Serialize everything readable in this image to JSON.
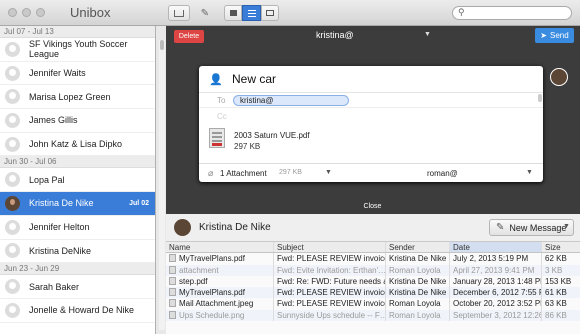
{
  "app": {
    "title": "Unibox"
  },
  "sidebar": {
    "groups": [
      {
        "date": "Jul 07 - Jul 13",
        "items": [
          {
            "name": "SF Vikings Youth Soccer League",
            "date": ""
          },
          {
            "name": "Jennifer Waits",
            "date": ""
          },
          {
            "name": "Marisa Lopez Green",
            "date": ""
          },
          {
            "name": "James Gillis",
            "date": ""
          },
          {
            "name": "John Katz & Lisa Dipko",
            "date": ""
          }
        ]
      },
      {
        "date": "Jun 30 - Jul 06",
        "items": [
          {
            "name": "Lopa Pal",
            "date": ""
          },
          {
            "name": "Kristina De Nike",
            "date": "Jul 02"
          },
          {
            "name": "Jennifer Helton",
            "date": ""
          },
          {
            "name": "Kristina DeNike",
            "date": ""
          }
        ]
      },
      {
        "date": "Jun 23 - Jun 29",
        "items": [
          {
            "name": "Sarah Baker",
            "date": ""
          },
          {
            "name": "Jonelle & Howard De Nike",
            "date": ""
          }
        ]
      }
    ]
  },
  "compose": {
    "delete_label": "Delete",
    "from_account": "kristina@",
    "send_label": "Send",
    "subject": "New car",
    "to_label": "To",
    "to_recipient": "kristina@",
    "cc_label": "Cc",
    "attachment": {
      "name": "2003 Saturn VUE.pdf",
      "size": "297 KB"
    },
    "attachment_count": "1 Attachment",
    "attachment_total": "297 KB",
    "signature": "roman@",
    "close_label": "Close"
  },
  "detail": {
    "contact_name": "Kristina De Nike",
    "new_message_label": "New Message"
  },
  "table": {
    "columns": [
      "Name",
      "Subject",
      "Sender",
      "Date",
      "Size"
    ],
    "rows": [
      {
        "name": "MyTravelPlans.pdf",
        "subject": "Fwd: PLEASE REVIEW invoice…",
        "sender": "Kristina De Nike",
        "date": "July 2, 2013 5:19 PM",
        "size": "62 KB",
        "dim": false
      },
      {
        "name": "attachment",
        "subject": "Fwd: Evite Invitation: Erthan'…",
        "sender": "Roman Loyola",
        "date": "April 27, 2013 9:41 PM",
        "size": "3 KB",
        "dim": true
      },
      {
        "name": "step.pdf",
        "subject": "Fwd: Re: FWD: Future needs a…",
        "sender": "Kristina De Nike",
        "date": "January 28, 2013 1:48 PM",
        "size": "153 KB",
        "dim": false
      },
      {
        "name": "MyTravelPlans.pdf",
        "subject": "Fwd: PLEASE REVIEW invoice…",
        "sender": "Kristina De Nike",
        "date": "December 6, 2012 7:55 PM",
        "size": "61 KB",
        "dim": false
      },
      {
        "name": "Mail Attachment.jpeg",
        "subject": "Fwd: PLEASE REVIEW invoice…",
        "sender": "Roman Loyola",
        "date": "October 20, 2012 3:52 PM",
        "size": "63 KB",
        "dim": false
      },
      {
        "name": "Ups Schedule.png",
        "subject": "Sunnyside Ups schedule -- F…",
        "sender": "Roman Loyola",
        "date": "September 3, 2012 12:26 PM",
        "size": "86 KB",
        "dim": true
      }
    ]
  }
}
